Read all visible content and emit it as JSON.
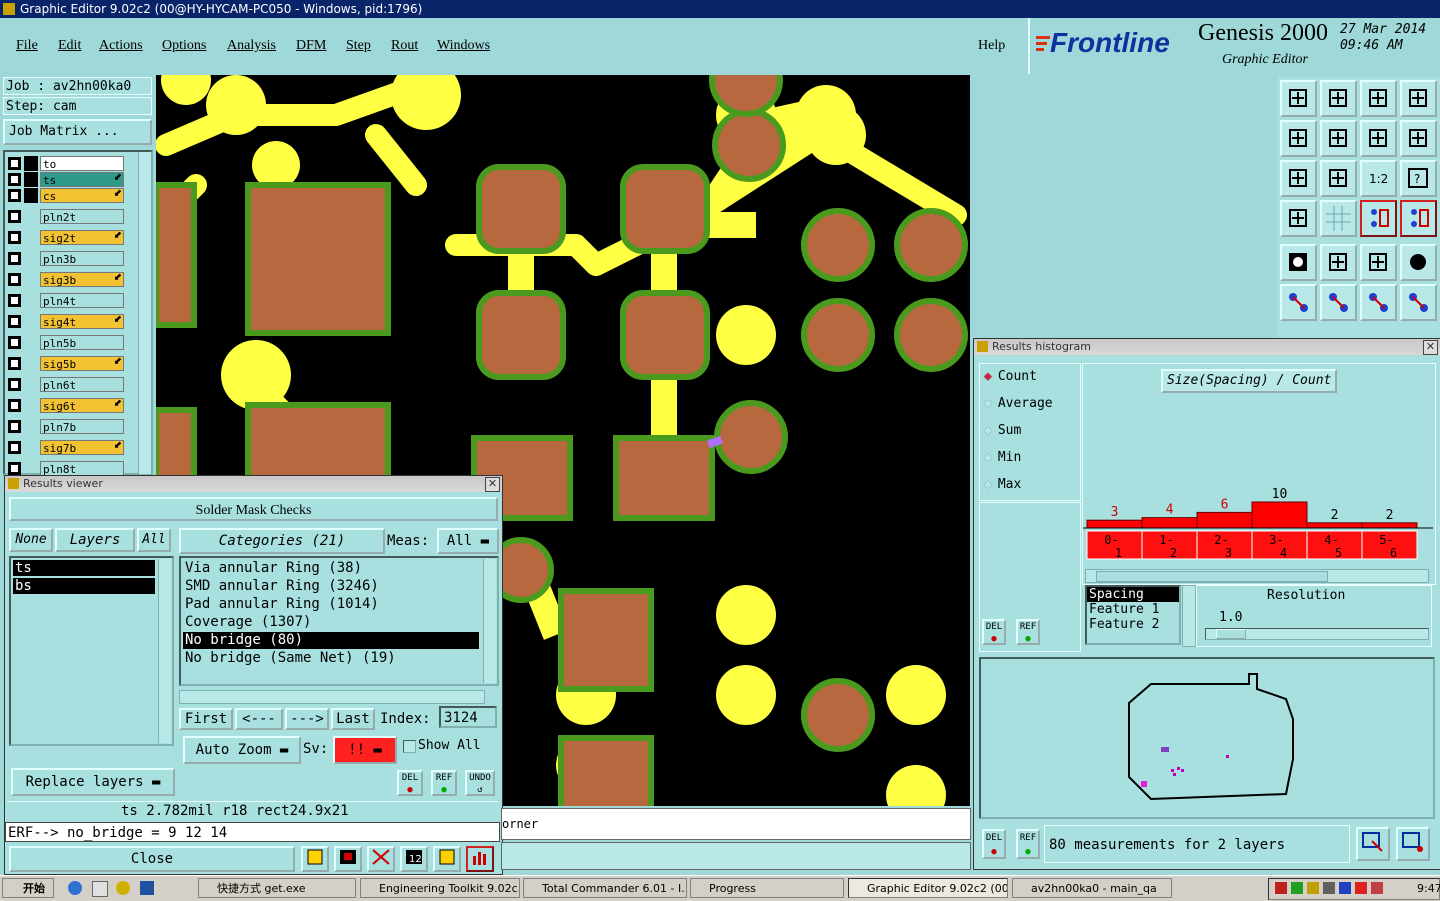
{
  "window": {
    "title": "Graphic Editor 9.02c2 (00@HY-HYCAM-PC050 - Windows, pid:1796)"
  },
  "menu": [
    "File",
    "Edit",
    "Actions",
    "Options",
    "Analysis",
    "DFM",
    "Step",
    "Rout",
    "Windows"
  ],
  "help_label": "Help",
  "brand": {
    "logo": "Frontline",
    "product": "Genesis 2000",
    "subtitle": "Graphic Editor",
    "date": "27 Mar 2014",
    "time": "09:46 AM"
  },
  "job": {
    "job_label": "Job : av2hn00ka0",
    "step_label": "Step: cam",
    "matrix_button": "Job Matrix ..."
  },
  "layers": [
    {
      "name": "to",
      "color": "#ffffff"
    },
    {
      "name": "ts",
      "color": "#2e9a8a"
    },
    {
      "name": "cs",
      "color": "#f2c232"
    },
    {
      "name": "pln2t",
      "color": "#a8e0e0"
    },
    {
      "name": "sig2t",
      "color": "#f2c232"
    },
    {
      "name": "pln3b",
      "color": "#a8e0e0"
    },
    {
      "name": "sig3b",
      "color": "#f2c232"
    },
    {
      "name": "pln4t",
      "color": "#a8e0e0"
    },
    {
      "name": "sig4t",
      "color": "#f2c232"
    },
    {
      "name": "pln5b",
      "color": "#a8e0e0"
    },
    {
      "name": "sig5b",
      "color": "#f2c232"
    },
    {
      "name": "pln6t",
      "color": "#a8e0e0"
    },
    {
      "name": "sig6t",
      "color": "#f2c232"
    },
    {
      "name": "pln7b",
      "color": "#a8e0e0"
    },
    {
      "name": "sig7b",
      "color": "#f2c232"
    },
    {
      "name": "pln8t",
      "color": "#a8e0e0"
    }
  ],
  "results_viewer": {
    "title": "Results viewer",
    "header": "Solder Mask Checks",
    "none_btn": "None",
    "layers_btn": "Layers",
    "all_btn": "All",
    "categories_btn": "Categories (21)",
    "meas_label": "Meas:",
    "meas_value": "All",
    "layer_items": [
      "ts",
      "bs"
    ],
    "categories": [
      "Via annular Ring (38)",
      "SMD annular Ring (3246)",
      "Pad annular Ring (1014)",
      "Coverage (1307)",
      "No bridge (80)",
      "No bridge (Same Net) (19)"
    ],
    "nav": {
      "first": "First",
      "prev": "<---",
      "next": "--->",
      "last": "Last",
      "index_label": "Index:",
      "index_value": "3124"
    },
    "auto_zoom": "Auto Zoom",
    "sv_label": "Sv:",
    "sv_value": "!!",
    "show_all": "Show All",
    "replace_layers": "Replace layers",
    "del": "DEL",
    "ref": "REF",
    "undo": "UNDO",
    "status_line": "ts 2.782mil  r18  rect24.9x21",
    "erf_line": "ERF--> no_bridge = 9 12 14",
    "close": "Close",
    "partial_text": "orner"
  },
  "histogram": {
    "title": "Results histogram",
    "options": [
      "Count",
      "Average",
      "Sum",
      "Min",
      "Max"
    ],
    "chart_title": "Size(Spacing) / Count",
    "bars": [
      {
        "count": "3",
        "range": [
          "0-",
          "1"
        ]
      },
      {
        "count": "4",
        "range": [
          "1-",
          "2"
        ]
      },
      {
        "count": "6",
        "range": [
          "2-",
          "3"
        ]
      },
      {
        "count": "10",
        "range": [
          "3-",
          "4"
        ]
      },
      {
        "count": "2",
        "range": [
          "4-",
          "5"
        ]
      },
      {
        "count": "2",
        "range": [
          "5-",
          "6"
        ]
      }
    ],
    "list": [
      "Spacing",
      "Feature 1",
      "Feature 2"
    ],
    "resolution_label": "Resolution",
    "resolution_value": "1.0",
    "del": "DEL",
    "ref": "REF",
    "status": "80 measurements for 2 layers"
  },
  "taskbar": {
    "start": "开始",
    "tasks": [
      "快捷方式 get.exe",
      "Engineering Toolkit 9.02c...",
      "Total Commander 6.01 - I...",
      "Progress",
      "Graphic Editor 9.02c2 (00...",
      "av2hn00ka0 - main_qa"
    ],
    "clock": "9:47"
  },
  "colors": {
    "bg": "#9fd8d8",
    "trace": "#ffff44",
    "pad": "#b8683e",
    "pad_ring": "#4a9a1e",
    "bar": "#ff0000"
  }
}
